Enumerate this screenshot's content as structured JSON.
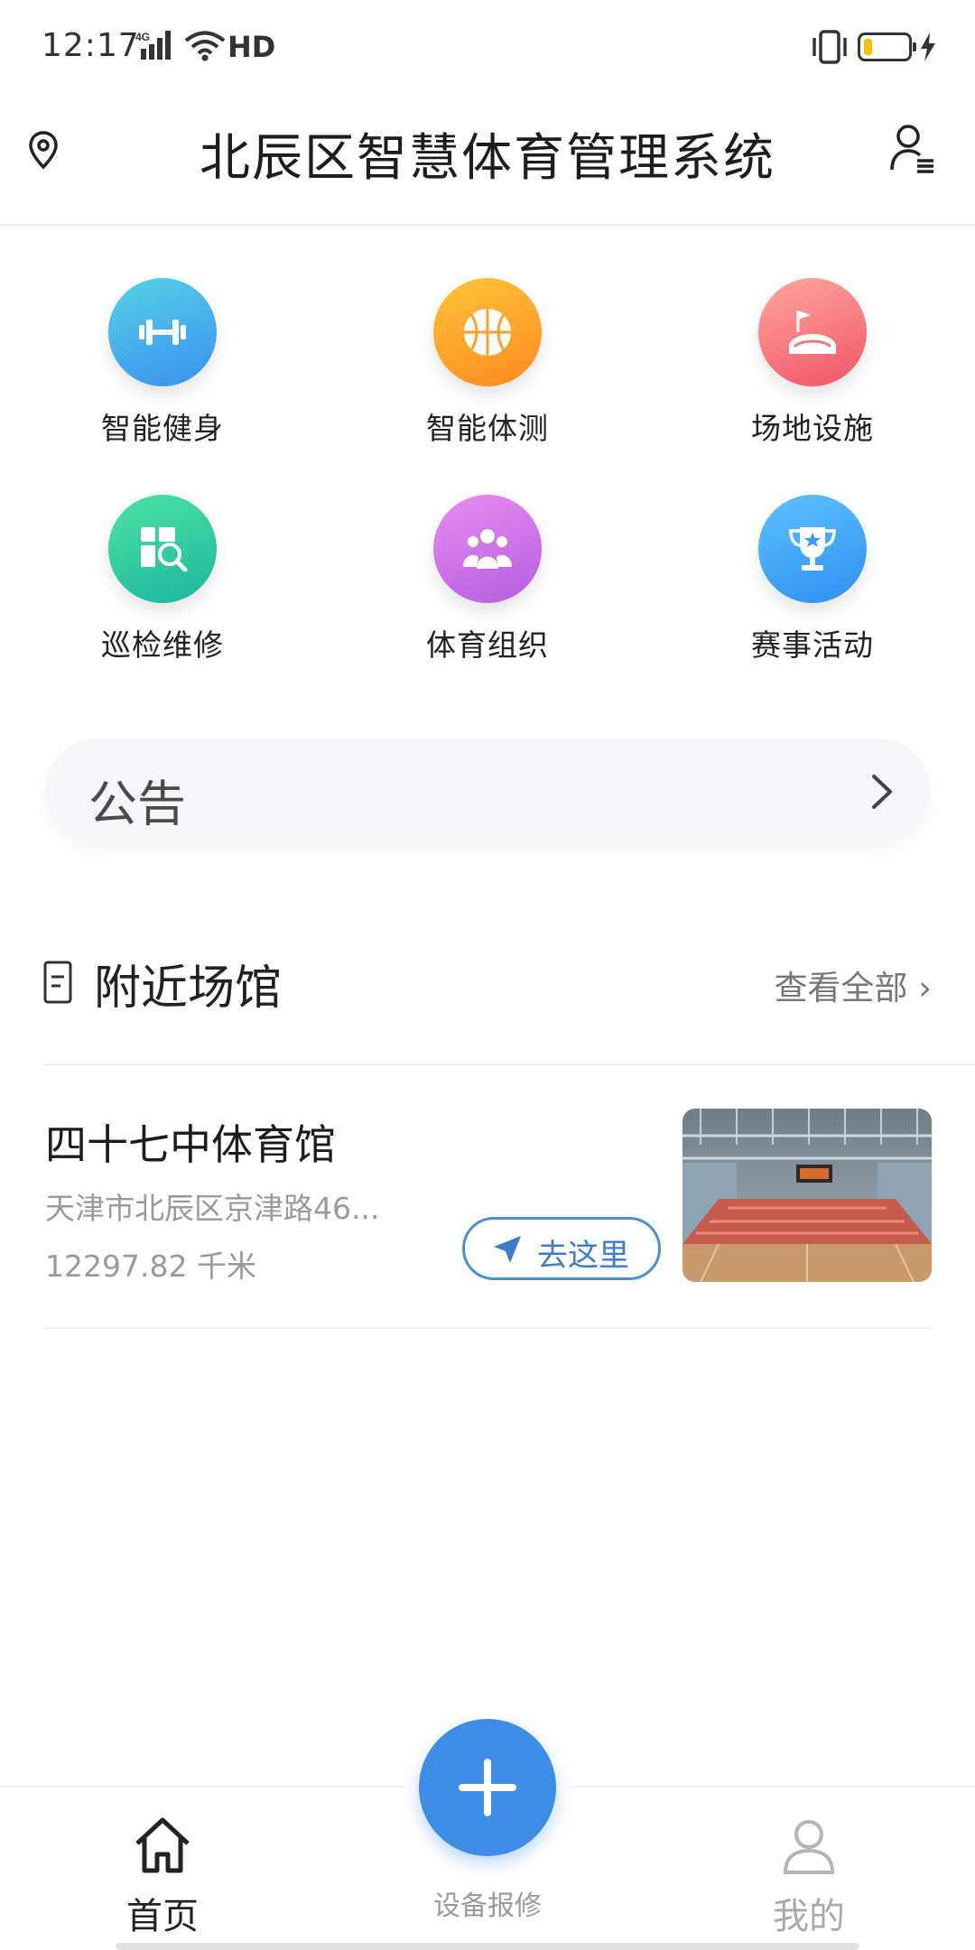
{
  "status_bar": {
    "time": "12:17",
    "network": "4G",
    "hd": "HD",
    "battery_level": 0.2,
    "battery_color": "#f5c400"
  },
  "header": {
    "title": "北辰区智慧体育管理系统",
    "left_icon": "location-pin-icon",
    "right_icon": "user-list-icon"
  },
  "features": [
    {
      "label": "智能健身",
      "icon": "dumbbell-icon",
      "gradient": [
        "#55d3e6",
        "#3b8ff0"
      ]
    },
    {
      "label": "智能体测",
      "icon": "basketball-icon",
      "gradient": [
        "#ffc43a",
        "#ff8a1e"
      ]
    },
    {
      "label": "场地设施",
      "icon": "stadium-flag-icon",
      "gradient": [
        "#ffa7a0",
        "#ef5563"
      ]
    },
    {
      "label": "巡检维修",
      "icon": "inspection-search-icon",
      "gradient": [
        "#4ee3a2",
        "#1bb6a0"
      ]
    },
    {
      "label": "体育组织",
      "icon": "group-people-icon",
      "gradient": [
        "#e98cf0",
        "#b45ee0"
      ]
    },
    {
      "label": "赛事活动",
      "icon": "trophy-icon",
      "gradient": [
        "#5fc2ff",
        "#2d8ff0"
      ]
    }
  ],
  "notice": {
    "label": "公告"
  },
  "nearby": {
    "title": "附近场馆",
    "view_all": "查看全部 ›",
    "venues": [
      {
        "name": "四十七中体育馆",
        "address": "天津市北辰区京津路46...",
        "distance": "12297.82 千米",
        "go_label": "去这里"
      }
    ]
  },
  "bottom_nav": {
    "home_label": "首页",
    "fab_label": "设备报修",
    "mine_label": "我的"
  },
  "colors": {
    "accent": "#3d8de6",
    "button_border": "#4a8fd8"
  }
}
